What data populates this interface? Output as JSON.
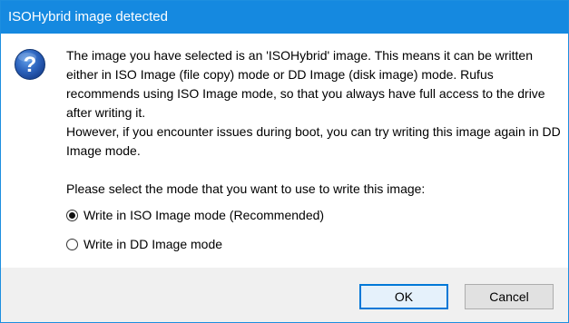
{
  "window": {
    "title": "ISOHybrid image detected"
  },
  "icon": {
    "name": "question-icon",
    "glyph": "?",
    "color": "#1a4fa3"
  },
  "message": {
    "paragraph1": "The image you have selected is an 'ISOHybrid' image. This means it can be written either in ISO Image (file copy) mode or DD Image (disk image) mode. Rufus recommends using ISO Image mode, so that you always have full access to the drive after writing it.",
    "paragraph2": "However, if you encounter issues during boot, you can try writing this image again in DD Image mode.",
    "prompt": "Please select the mode that you want to use to write this image:"
  },
  "options": [
    {
      "label": "Write in ISO Image mode (Recommended)",
      "selected": true
    },
    {
      "label": "Write in DD Image mode",
      "selected": false
    }
  ],
  "buttons": {
    "ok": "OK",
    "cancel": "Cancel"
  },
  "colors": {
    "titlebar": "#1589e0",
    "footer": "#f0f0f0",
    "ok_border": "#0078d7"
  }
}
